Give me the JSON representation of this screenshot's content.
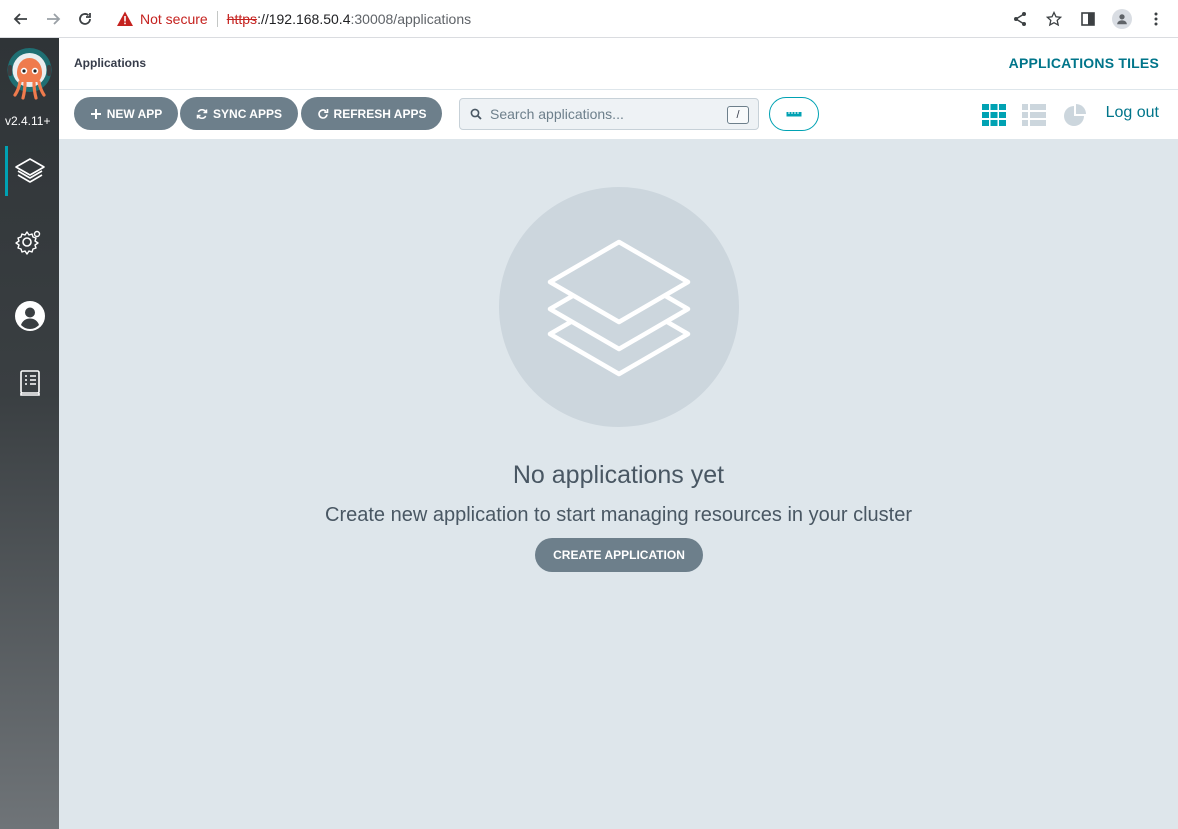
{
  "browser": {
    "security_label": "Not secure",
    "url_scheme": "https",
    "url_host": "://192.168.50.4",
    "url_path": ":30008/applications"
  },
  "sidebar": {
    "version": "v2.4.11+",
    "items": [
      {
        "name": "applications",
        "icon": "layers-icon",
        "active": true
      },
      {
        "name": "settings",
        "icon": "gear-icon",
        "active": false
      },
      {
        "name": "user-info",
        "icon": "user-icon",
        "active": false
      },
      {
        "name": "documentation",
        "icon": "docs-icon",
        "active": false
      }
    ]
  },
  "header": {
    "title": "Applications",
    "view_title": "APPLICATIONS TILES"
  },
  "toolbar": {
    "new_app_label": "NEW APP",
    "sync_apps_label": "SYNC APPS",
    "refresh_apps_label": "REFRESH APPS",
    "search_placeholder": "Search applications...",
    "search_shortcut": "/",
    "logout_label": "Log out"
  },
  "empty_state": {
    "title": "No applications yet",
    "subtitle": "Create new application to start managing resources in your cluster",
    "button_label": "CREATE APPLICATION"
  },
  "colors": {
    "accent": "#00a2b3",
    "accent_dark": "#00758a",
    "button_gray": "#6d7f8b",
    "background": "#dee6eb"
  }
}
